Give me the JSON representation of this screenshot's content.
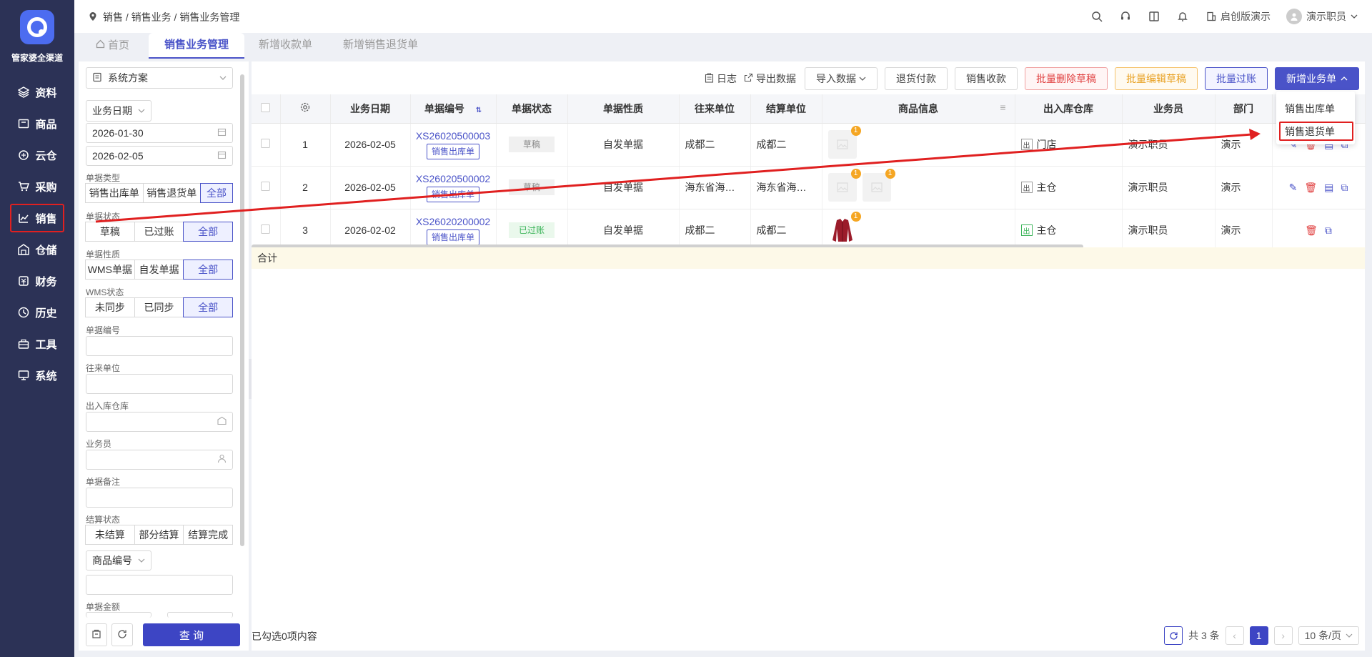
{
  "app": {
    "brand": "管家婆全渠道"
  },
  "sidebar": {
    "items": [
      {
        "label": "资料",
        "icon": "layers-icon"
      },
      {
        "label": "商品",
        "icon": "goods-icon"
      },
      {
        "label": "云仓",
        "icon": "cloud-icon"
      },
      {
        "label": "采购",
        "icon": "cart-icon"
      },
      {
        "label": "销售",
        "icon": "chart-icon",
        "active": true
      },
      {
        "label": "仓储",
        "icon": "warehouse-icon"
      },
      {
        "label": "财务",
        "icon": "finance-icon"
      },
      {
        "label": "历史",
        "icon": "history-icon"
      },
      {
        "label": "工具",
        "icon": "toolbox-icon"
      },
      {
        "label": "系统",
        "icon": "monitor-icon"
      }
    ]
  },
  "header": {
    "breadcrumb": "销售 / 销售业务 / 销售业务管理",
    "company": "启创版演示",
    "user": "演示职员"
  },
  "tabs": [
    {
      "label": "首页"
    },
    {
      "label": "销售业务管理",
      "active": true
    },
    {
      "label": "新增收款单"
    },
    {
      "label": "新增销售退货单"
    }
  ],
  "filter": {
    "scheme": "系统方案",
    "date_type": "业务日期",
    "date_from": "2026-01-30",
    "date_to": "2026-02-05",
    "doc_type_label": "单据类型",
    "doc_type_options": [
      "销售出库单",
      "销售退货单",
      "全部"
    ],
    "doc_status_label": "单据状态",
    "doc_status_options": [
      "草稿",
      "已过账",
      "全部"
    ],
    "doc_nature_label": "单据性质",
    "doc_nature_options": [
      "WMS单据",
      "自发单据",
      "全部"
    ],
    "wms_label": "WMS状态",
    "wms_options": [
      "未同步",
      "已同步",
      "全部"
    ],
    "doc_no_label": "单据编号",
    "partner_label": "往来单位",
    "warehouse_label": "出入库仓库",
    "salesman_label": "业务员",
    "remark_label": "单据备注",
    "settle_label": "结算状态",
    "settle_options": [
      "未结算",
      "部分结算",
      "结算完成"
    ],
    "product_code": "商品编号",
    "amount_label": "单据金额",
    "query_button": "查 询"
  },
  "toolbar": {
    "log": "日志",
    "export": "导出数据",
    "import": "导入数据",
    "refund": "退货付款",
    "receipt": "销售收款",
    "batch_delete": "批量删除草稿",
    "batch_edit": "批量编辑草稿",
    "batch_post": "批量过账",
    "new_doc": "新增业务单"
  },
  "dropdown": {
    "items": [
      "销售出库单",
      "销售退货单"
    ],
    "highlighted": "销售退货单"
  },
  "table": {
    "columns": [
      "业务日期",
      "单据编号",
      "单据状态",
      "单据性质",
      "往来单位",
      "结算单位",
      "商品信息",
      "出入库仓库",
      "业务员",
      "部门"
    ],
    "rows": [
      {
        "no": "1",
        "date": "2026-02-05",
        "code": "XS26020500003",
        "type": "销售出库单",
        "status": "草稿",
        "nature": "自发单据",
        "partner": "成都二",
        "settle": "成都二",
        "thumbs": 1,
        "wh_tag": "出",
        "warehouse": "门店",
        "salesman": "演示职员",
        "dept": "演示"
      },
      {
        "no": "2",
        "date": "2026-02-05",
        "code": "XS26020500002",
        "type": "销售出库单",
        "status": "草稿",
        "nature": "自发单据",
        "partner": "海东省海…",
        "settle": "海东省海…",
        "thumbs": 2,
        "wh_tag": "出",
        "warehouse": "主仓",
        "salesman": "演示职员",
        "dept": "演示"
      },
      {
        "no": "3",
        "date": "2026-02-02",
        "code": "XS26020200002",
        "type": "销售出库单",
        "status": "已过账",
        "nature": "自发单据",
        "partner": "成都二",
        "settle": "成都二",
        "thumbs": 1,
        "wh_tag": "出",
        "warehouse": "主仓",
        "salesman": "演示职员",
        "dept": "演示"
      }
    ],
    "thumb_badge": "1",
    "summary": "合计"
  },
  "footer": {
    "selected": "已勾选0项内容",
    "total": "共 3 条",
    "page": "1",
    "page_size": "10 条/页"
  },
  "colors": {
    "sidebar": "#2c3256",
    "accent": "#4a53c8",
    "highlight": "#e02020"
  }
}
